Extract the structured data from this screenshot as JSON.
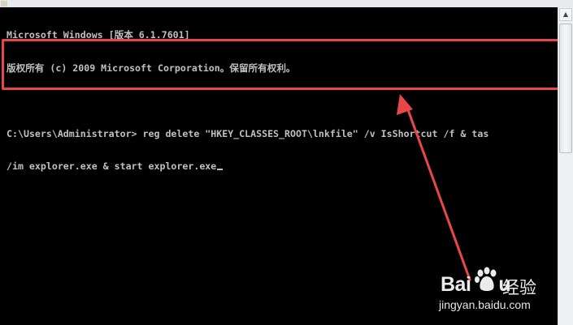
{
  "console": {
    "lines": [
      "Microsoft Windows [版本 6.1.7601]",
      "版权所有 (c) 2009 Microsoft Corporation。保留所有权利。",
      "",
      "C:\\Users\\Administrator> reg delete \"HKEY_CLASSES_ROOT\\lnkfile\" /v IsShortcut /f & tas",
      "/im explorer.exe & start explorer.exe"
    ]
  },
  "watermark": {
    "brand": "Bai",
    "brand_suffix": "u",
    "label": "经验",
    "url": "jingyan.baidu.com"
  },
  "icons": {
    "scroll_up": "▲",
    "paw": "paw-icon"
  },
  "colors": {
    "console_background": "#000000",
    "console_text": "#c0c0c0",
    "highlight": "#e8474a",
    "scrollbar": "#eef0f1"
  }
}
